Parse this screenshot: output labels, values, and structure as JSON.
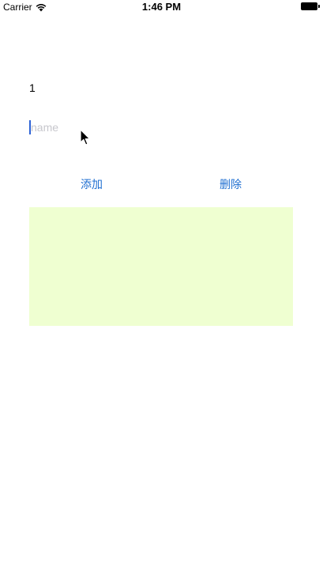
{
  "status_bar": {
    "carrier": "Carrier",
    "time": "1:46 PM",
    "wifi_icon": "wifi-icon",
    "battery_icon": "battery-icon",
    "battery_level": 1.0
  },
  "main": {
    "count_label": "1",
    "name_input": {
      "value": "",
      "placeholder": "name"
    },
    "add_label": "添加",
    "delete_label": "删除",
    "green_view_color": "#efffd1"
  },
  "colors": {
    "accent": "#1f6fd1",
    "caret": "#2e63d6",
    "placeholder": "#c7c7cd"
  }
}
